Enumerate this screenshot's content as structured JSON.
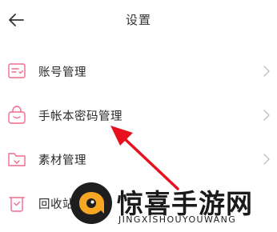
{
  "header": {
    "title": "设置",
    "back_icon": "arrow-left-icon"
  },
  "menu": [
    {
      "label": "账号管理",
      "icon": "account-card-icon"
    },
    {
      "label": "手帐本密码管理",
      "icon": "lock-book-icon"
    },
    {
      "label": "素材管理",
      "icon": "folder-icon"
    },
    {
      "label": "回收站",
      "icon": "trash-icon"
    }
  ],
  "watermark": {
    "title": "惊喜手游网",
    "subtitle": "JINGXISHOUYOUWANG"
  },
  "colors": {
    "accent": "#f06a8e",
    "arrow": "#e8101e",
    "logo_orange": "#f6a623"
  }
}
